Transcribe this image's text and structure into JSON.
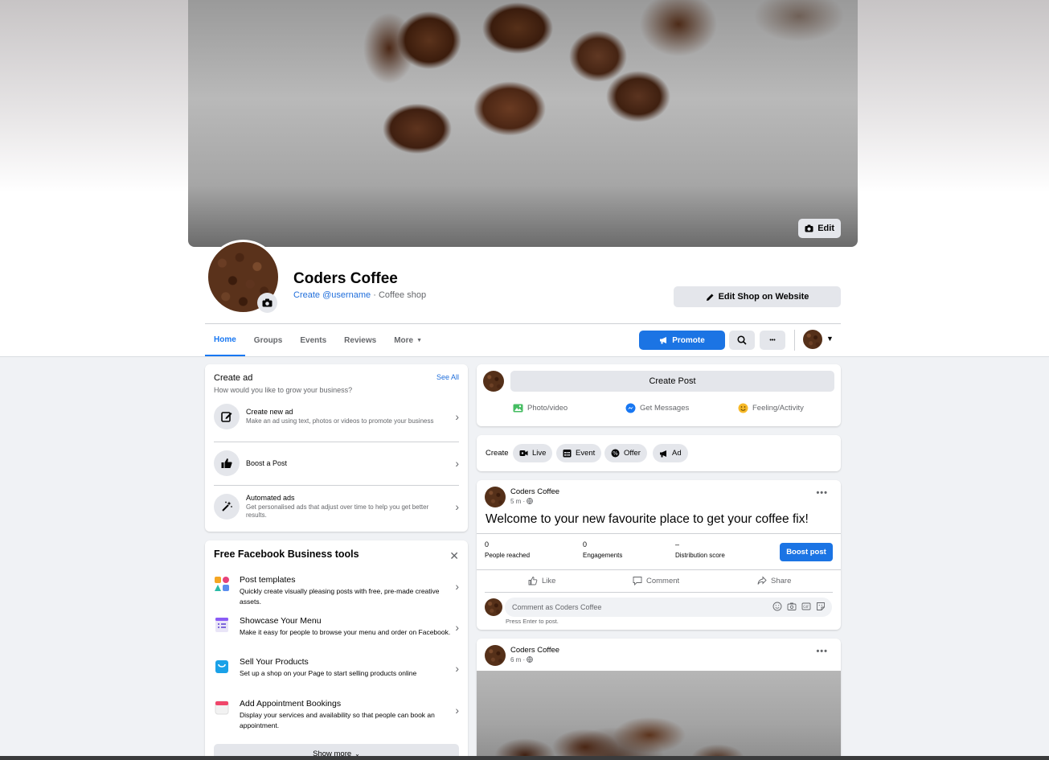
{
  "cover": {
    "edit_label": "Edit"
  },
  "profile": {
    "name": "Coders Coffee",
    "username_link": "Create @username",
    "separator": "·",
    "category": "Coffee shop"
  },
  "header_actions": {
    "edit_shop_label": "Edit Shop on Website"
  },
  "tabs": [
    {
      "label": "Home"
    },
    {
      "label": "Groups"
    },
    {
      "label": "Events"
    },
    {
      "label": "Reviews"
    },
    {
      "label": "More"
    }
  ],
  "toolbar": {
    "promote_label": "Promote",
    "more_dots": "•••"
  },
  "create_ad": {
    "title": "Create ad",
    "see_all": "See All",
    "subtitle": "How would you like to grow your business?",
    "items": [
      {
        "title": "Create new ad",
        "desc": "Make an ad using text, photos or videos to promote your business"
      },
      {
        "title": "Boost a Post",
        "desc": ""
      },
      {
        "title": "Automated ads",
        "desc": "Get personalised ads that adjust over time to help you get better results."
      }
    ]
  },
  "business_tools": {
    "title": "Free Facebook Business tools",
    "items": [
      {
        "title": "Post templates",
        "desc": "Quickly create visually pleasing posts with free, pre-made creative assets."
      },
      {
        "title": "Showcase Your Menu",
        "desc": "Make it easy for people to browse your menu and order on Facebook."
      },
      {
        "title": "Sell Your Products",
        "desc": "Set up a shop on your Page to start selling products online"
      },
      {
        "title": "Add Appointment Bookings",
        "desc": "Display your services and availability so that people can book an appointment."
      }
    ],
    "show_more": "Show more"
  },
  "composer": {
    "create_post": "Create Post",
    "actions": [
      {
        "label": "Photo/video"
      },
      {
        "label": "Get Messages"
      },
      {
        "label": "Feeling/Activity"
      }
    ]
  },
  "create_row": {
    "label": "Create",
    "pills": [
      {
        "label": "Live"
      },
      {
        "label": "Event"
      },
      {
        "label": "Offer"
      },
      {
        "label": "Ad"
      }
    ]
  },
  "post": {
    "author": "Coders Coffee",
    "time": "5 m ·",
    "text": "Welcome to your new favourite place to get your coffee fix!",
    "stats": [
      {
        "value": "0",
        "label": "People reached"
      },
      {
        "value": "0",
        "label": "Engagements"
      },
      {
        "value": "–",
        "label": "Distribution score"
      }
    ],
    "boost_label": "Boost post",
    "reactions": [
      {
        "label": "Like"
      },
      {
        "label": "Comment"
      },
      {
        "label": "Share"
      }
    ],
    "comment_placeholder": "Comment as Coders Coffee",
    "comment_hint": "Press Enter to post."
  },
  "post2": {
    "author": "Coders Coffee",
    "time": "6 m ·"
  },
  "colors": {
    "accent": "#1877f2",
    "button_blue": "#1b74e4",
    "surface": "#ffffff",
    "background": "#f0f2f5",
    "secondary_button": "#e4e6eb",
    "muted_text": "#65676b"
  }
}
